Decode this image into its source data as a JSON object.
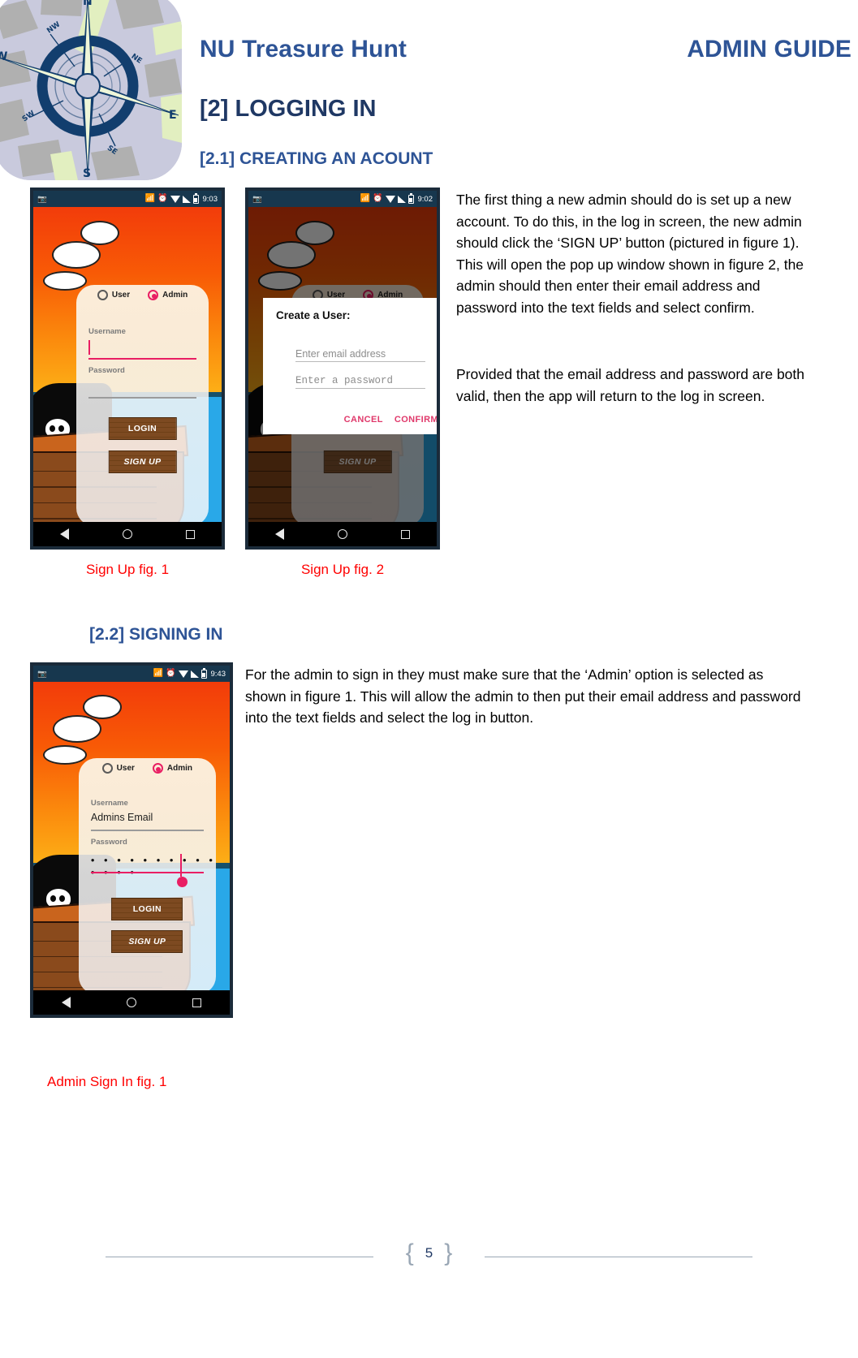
{
  "document": {
    "header": {
      "app_title": "NU Treasure Hunt",
      "guide_title": "ADMIN GUIDE",
      "logo_icon": "compass-rose-map-icon"
    },
    "headings": {
      "section": "[2] LOGGING IN",
      "sub_1": "[2.1] CREATING AN ACOUNT",
      "sub_2": "[2.2] SIGNING IN"
    },
    "paragraphs": {
      "p1": "The first thing a new admin should do is set up a new account. To do this, in the log in screen, the new admin should click the ‘SIGN UP’ button (pictured in figure 1). This will open the pop up window shown in figure 2, the admin should then enter their email address and password into the text fields and select confirm.",
      "p2": "Provided that the email address and password are both valid, then the app will return to the log in screen.",
      "p3": "For the admin to sign in they must make sure that the ‘Admin’ option is selected as shown in figure 1. This will allow the admin to then put their email address and password into the text fields and select the log in button."
    },
    "captions": {
      "fig1": "Sign Up fig. 1",
      "fig2": "Sign Up fig. 2",
      "fig3": "Admin Sign In fig. 1"
    },
    "footer": {
      "page_number": "5"
    },
    "colors": {
      "heading_blue": "#2e5496",
      "heading_dark_blue": "#1f3864",
      "caption_red": "#ff0000",
      "highlight_red": "#ee1c1c",
      "accent_pink": "#e91e63",
      "status_bar": "#17374e"
    }
  },
  "screenshots": {
    "fig1": {
      "status_time": "9:03",
      "radio_user": "User",
      "radio_admin": "Admin",
      "selected_radio": "Admin",
      "label_username": "Username",
      "value_username": "",
      "label_password": "Password",
      "value_password": "",
      "btn_login": "LOGIN",
      "btn_signup": "SIGN UP",
      "highlighted_control": "SIGN UP"
    },
    "fig2": {
      "status_time": "9:02",
      "radio_user": "User",
      "radio_admin": "Admin",
      "selected_radio": "Admin",
      "dialog_title": "Create a User:",
      "placeholder_email": "Enter email address",
      "placeholder_password": "Enter a password",
      "btn_cancel": "CANCEL",
      "btn_confirm": "CONFIRM",
      "btn_signup": "SIGN UP"
    },
    "fig3": {
      "status_time": "9:43",
      "radio_user": "User",
      "radio_admin": "Admin",
      "selected_radio": "Admin",
      "label_username": "Username",
      "value_username": "Admins Email",
      "label_password": "Password",
      "value_password": "• • • • • • • • • • • • • •",
      "btn_login": "LOGIN",
      "btn_signup": "SIGN UP"
    }
  },
  "nav_icons": {
    "back": "back-triangle-icon",
    "home": "home-circle-icon",
    "recents": "recents-square-icon"
  }
}
